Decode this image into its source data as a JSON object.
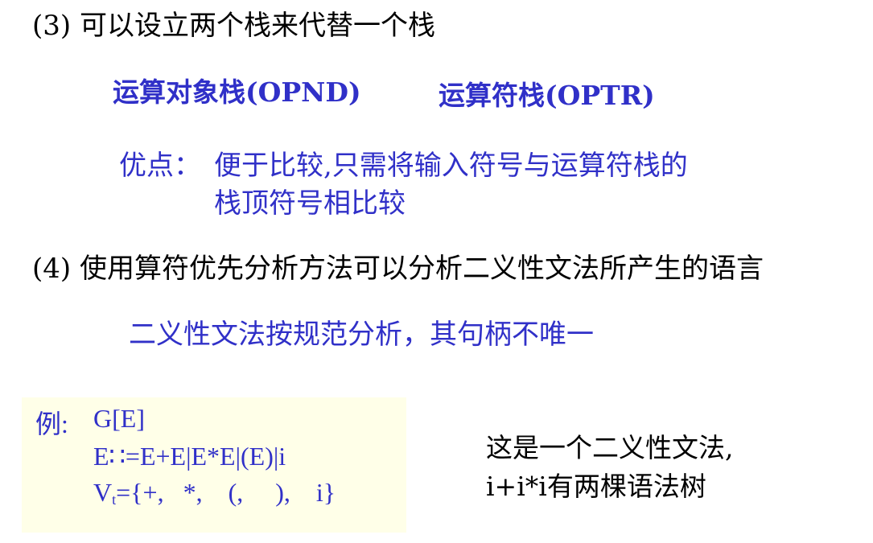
{
  "section3": {
    "heading": "(3) 可以设立两个栈来代替一个栈",
    "opnd_stack": "运算对象栈(OPND)",
    "optr_stack": "运算符栈(OPTR)",
    "advantage_label": "优点：",
    "advantage_line1": "便于比较,只需将输入符号与运算符栈的",
    "advantage_line2": "栈顶符号相比较"
  },
  "section4": {
    "heading": "(4) 使用算符优先分析方法可以分析二义性文法所产生的语言",
    "note": "二义性文法按规范分析，其句柄不唯一"
  },
  "example": {
    "label": "例:",
    "grammar": "G[E]",
    "rule": "E∷=E+E|E*E|(E)|i",
    "terminals_prefix": "V",
    "terminals_subscript": "t",
    "terminals_set": "={+,   *,    (,     ),    i}"
  },
  "remark": {
    "line1": "这是一个二义性文法,",
    "line2": "i+i*i有两棵语法树"
  },
  "colors": {
    "blue_text": "#3030c8",
    "example_background": "#ffffe8"
  }
}
